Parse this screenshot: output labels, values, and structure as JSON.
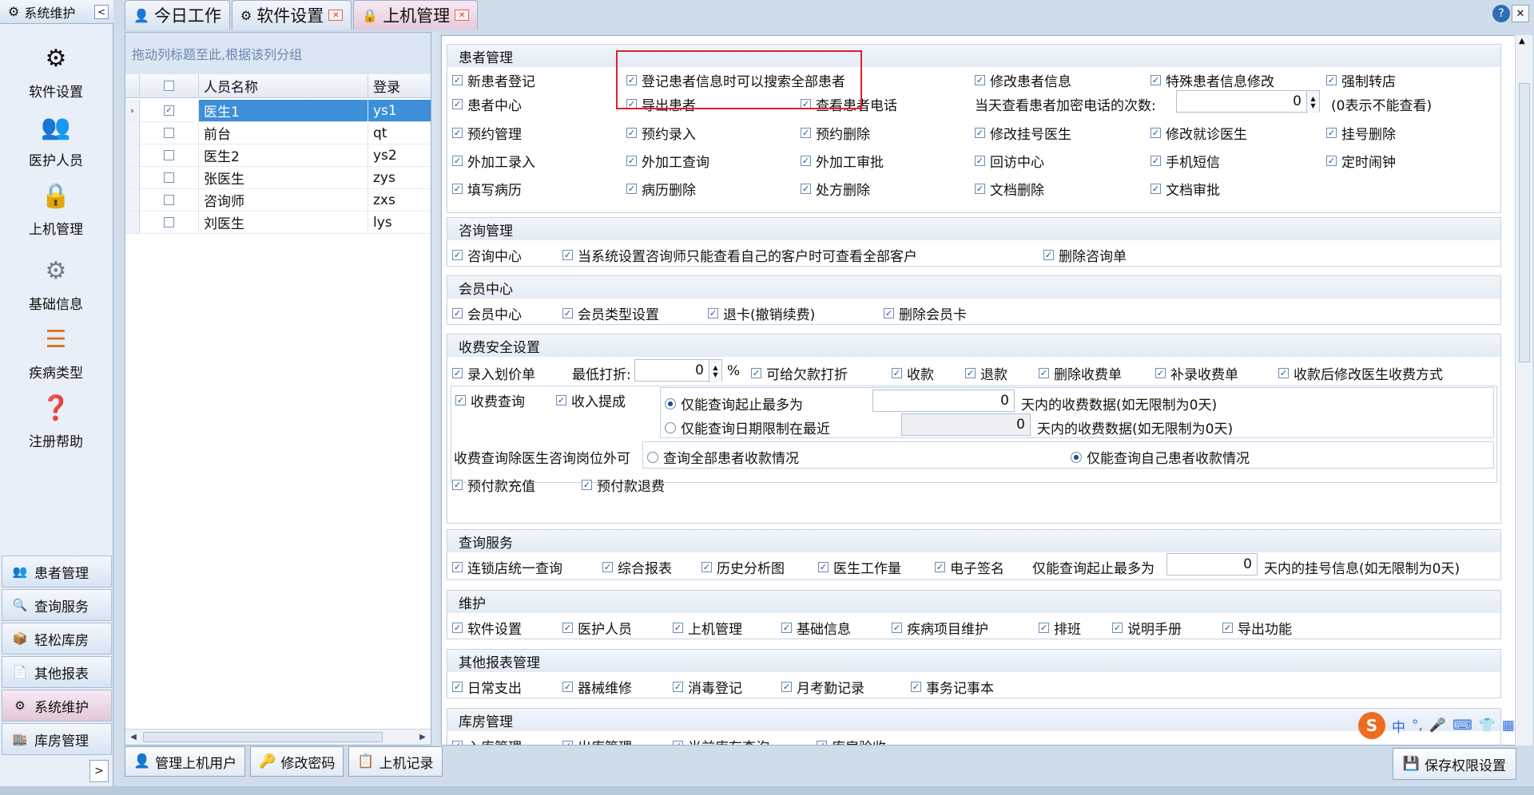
{
  "sidebar": {
    "header": "系统维护",
    "collapse": "<",
    "items": [
      {
        "label": "软件设置",
        "icon": "gears-icon"
      },
      {
        "label": "医护人员",
        "icon": "people-icon"
      },
      {
        "label": "上机管理",
        "icon": "lock-icon"
      },
      {
        "label": "基础信息",
        "icon": "settings-doc-icon"
      },
      {
        "label": "疾病类型",
        "icon": "tree-icon"
      },
      {
        "label": "注册帮助",
        "icon": "help-book-icon"
      }
    ],
    "nav": [
      {
        "label": "患者管理",
        "icon": "patients-icon"
      },
      {
        "label": "查询服务",
        "icon": "query-icon"
      },
      {
        "label": "轻松库房",
        "icon": "warehouse-icon"
      },
      {
        "label": "其他报表",
        "icon": "report-icon"
      },
      {
        "label": "系统维护",
        "icon": "maintenance-icon"
      },
      {
        "label": "库房管理",
        "icon": "storage-icon"
      }
    ],
    "expand": ">"
  },
  "tabs": [
    {
      "label": "今日工作",
      "icon": "user-icon"
    },
    {
      "label": "软件设置",
      "icon": "gear-icon",
      "close": "✕"
    },
    {
      "label": "上机管理",
      "icon": "lock-icon",
      "close": "✕"
    }
  ],
  "help_glyph": "?",
  "close_glyph": "✕",
  "users_grid": {
    "group_hint": "拖动列标题至此,根据该列分组",
    "col_name": "人员名称",
    "col_login": "登录",
    "rows": [
      {
        "name": "医生1",
        "login": "ys1",
        "checked": "✓",
        "indicator": "›"
      },
      {
        "name": "前台",
        "login": "qt",
        "checked": "",
        "indicator": ""
      },
      {
        "name": "医生2",
        "login": "ys2",
        "checked": "",
        "indicator": ""
      },
      {
        "name": "张医生",
        "login": "zys",
        "checked": "",
        "indicator": ""
      },
      {
        "name": "咨询师",
        "login": "zxs",
        "checked": "",
        "indicator": ""
      },
      {
        "name": "刘医生",
        "login": "lys",
        "checked": "",
        "indicator": ""
      }
    ]
  },
  "bottom_buttons": {
    "manage_users": "管理上机用户",
    "change_password": "修改密码",
    "login_records": "上机记录",
    "save_permissions": "保存权限设置"
  },
  "perm": {
    "patient": {
      "title": "患者管理",
      "new_patient": "新患者登记",
      "search_all": "登记患者信息时可以搜索全部患者",
      "edit_info": "修改患者信息",
      "special_edit": "特殊患者信息修改",
      "force_transfer": "强制转店",
      "center": "患者中心",
      "export": "导出患者",
      "view_phone": "查看患者电话",
      "phone_times_label": "当天查看患者加密电话的次数:",
      "phone_times_value": "0",
      "phone_times_hint": "(0表示不能查看)",
      "appt_mgmt": "预约管理",
      "appt_entry": "预约录入",
      "appt_delete": "预约删除",
      "edit_reg_doctor": "修改挂号医生",
      "edit_doctor": "修改就诊医生",
      "reg_delete": "挂号删除",
      "ext_entry": "外加工录入",
      "ext_query": "外加工查询",
      "ext_approve": "外加工审批",
      "revisit": "回访中心",
      "sms": "手机短信",
      "alarm": "定时闹钟",
      "record": "填写病历",
      "record_delete": "病历删除",
      "rx_delete": "处方删除",
      "doc_delete": "文档删除",
      "doc_approve": "文档审批"
    },
    "consult": {
      "title": "咨询管理",
      "center": "咨询中心",
      "view_all": "当系统设置咨询师只能查看自己的客户时可查看全部客户",
      "delete": "删除咨询单"
    },
    "member": {
      "title": "会员中心",
      "center": "会员中心",
      "type_setting": "会员类型设置",
      "refund": "退卡(撤销续费)",
      "delete_card": "删除会员卡"
    },
    "fee": {
      "title": "收费安全设置",
      "entry": "录入划价单",
      "min_discount_label": "最低打折:",
      "min_discount_value": "0",
      "percent": "%",
      "debt_discount": "可给欠款打折",
      "charge": "收款",
      "refund": "退款",
      "delete_bill": "删除收费单",
      "add_bill": "补录收费单",
      "edit_doctor_after": "收款后修改医生收费方式",
      "query": "收费查询",
      "commission": "收入提成",
      "opt_max_days": "仅能查询起止最多为",
      "max_days_value": "0",
      "max_days_hint": "天内的收费数据(如无限制为0天)",
      "opt_recent_days": "仅能查询日期限制在最近",
      "recent_days_value": "0",
      "recent_days_hint": "天内的收费数据(如无限制为0天)",
      "except_label": "收费查询除医生咨询岗位外可",
      "opt_all_patients": "查询全部患者收款情况",
      "opt_own_patients": "仅能查询自己患者收款情况",
      "prepay": "预付款充值",
      "prepay_refund": "预付款退费"
    },
    "query": {
      "title": "查询服务",
      "chain": "连锁店统一查询",
      "summary": "综合报表",
      "history": "历史分析图",
      "workload": "医生工作量",
      "esign": "电子签名",
      "max_days_label": "仅能查询起止最多为",
      "max_days_value": "0",
      "max_days_hint": "天内的挂号信息(如无限制为0天)"
    },
    "maint": {
      "title": "维护",
      "software": "软件设置",
      "staff": "医护人员",
      "login_mgmt": "上机管理",
      "basic": "基础信息",
      "disease": "疾病项目维护",
      "schedule": "排班",
      "manual": "说明手册",
      "export": "导出功能"
    },
    "other": {
      "title": "其他报表管理",
      "expense": "日常支出",
      "repair": "器械维修",
      "disinfect": "消毒登记",
      "attendance": "月考勤记录",
      "memo": "事务记事本"
    },
    "warehouse": {
      "title": "库房管理",
      "in": "入库管理",
      "out": "出库管理",
      "stock": "当前库存查询",
      "accept": "库房验收"
    }
  },
  "ime": {
    "logo": "S",
    "lang": "中"
  },
  "check_glyph": "✓",
  "radio_glyph": "●"
}
